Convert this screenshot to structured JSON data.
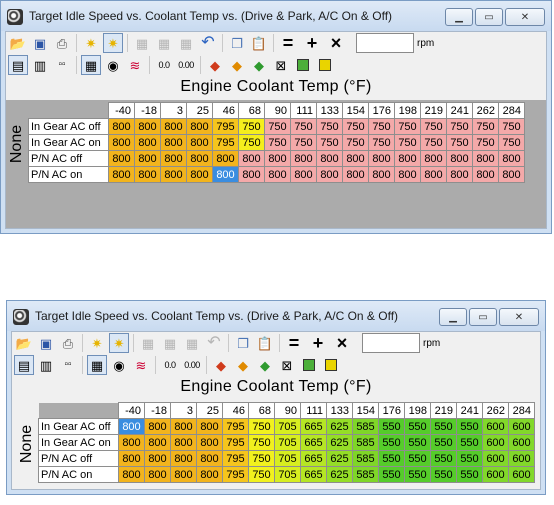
{
  "window1": {
    "title": "Target Idle Speed vs. Coolant Temp vs. (Drive & Park, A/C On & Off)",
    "x_axis_title": "Engine Coolant Temp (°F)",
    "y_axis_title": "None",
    "rpm_value": "",
    "rpm_label": "rpm",
    "columns": [
      "-40",
      "-18",
      "3",
      "25",
      "46",
      "68",
      "90",
      "111",
      "133",
      "154",
      "176",
      "198",
      "219",
      "241",
      "262",
      "284"
    ],
    "rows": [
      {
        "label": "In Gear AC off",
        "values": [
          "800",
          "800",
          "800",
          "800",
          "795",
          "750",
          "750",
          "750",
          "750",
          "750",
          "750",
          "750",
          "750",
          "750",
          "750",
          "750"
        ]
      },
      {
        "label": "In Gear AC on",
        "values": [
          "800",
          "800",
          "800",
          "800",
          "795",
          "750",
          "750",
          "750",
          "750",
          "750",
          "750",
          "750",
          "750",
          "750",
          "750",
          "750"
        ]
      },
      {
        "label": "P/N AC off",
        "values": [
          "800",
          "800",
          "800",
          "800",
          "800",
          "800",
          "800",
          "800",
          "800",
          "800",
          "800",
          "800",
          "800",
          "800",
          "800",
          "800"
        ]
      },
      {
        "label": "P/N AC on",
        "values": [
          "800",
          "800",
          "800",
          "800",
          "800",
          "800",
          "800",
          "800",
          "800",
          "800",
          "800",
          "800",
          "800",
          "800",
          "800",
          "800"
        ]
      }
    ]
  },
  "window2": {
    "title": "Target Idle Speed vs. Coolant Temp vs. (Drive & Park, A/C On & Off)",
    "x_axis_title": "Engine Coolant Temp (°F)",
    "y_axis_title": "None",
    "rpm_value": "",
    "rpm_label": "rpm",
    "columns": [
      "-40",
      "-18",
      "3",
      "25",
      "46",
      "68",
      "90",
      "111",
      "133",
      "154",
      "176",
      "198",
      "219",
      "241",
      "262",
      "284"
    ],
    "rows": [
      {
        "label": "In Gear AC off",
        "values": [
          "800",
          "800",
          "800",
          "800",
          "795",
          "750",
          "705",
          "665",
          "625",
          "585",
          "550",
          "550",
          "550",
          "550",
          "600",
          "600"
        ]
      },
      {
        "label": "In Gear AC on",
        "values": [
          "800",
          "800",
          "800",
          "800",
          "795",
          "750",
          "705",
          "665",
          "625",
          "585",
          "550",
          "550",
          "550",
          "550",
          "600",
          "600"
        ]
      },
      {
        "label": "P/N AC off",
        "values": [
          "800",
          "800",
          "800",
          "800",
          "795",
          "750",
          "705",
          "665",
          "625",
          "585",
          "550",
          "550",
          "550",
          "550",
          "600",
          "600"
        ]
      },
      {
        "label": "P/N AC on",
        "values": [
          "800",
          "800",
          "800",
          "800",
          "795",
          "750",
          "705",
          "665",
          "625",
          "585",
          "550",
          "550",
          "550",
          "550",
          "600",
          "600"
        ]
      }
    ]
  },
  "toolbar": {
    "equals_symbol": "=",
    "plus_symbol": "+",
    "times_symbol": "×",
    "zoom_in_label": "0.0",
    "zoom_out_label": "0.00"
  },
  "icons": [
    "open-folder-icon",
    "save-icon",
    "print-icon",
    "star-icon",
    "star-pressed-icon",
    "copy-table-icon",
    "paste-table-icon",
    "compare-icon",
    "undo-icon",
    "copy-icon",
    "paste-icon",
    "table-view-icon",
    "chart-view-icon",
    "grid-icon",
    "3d-view-icon",
    "graph-icon",
    "increment-icon",
    "decrement-icon",
    "interpolate-icon",
    "smooth-icon",
    "fill-icon",
    "fit-icon",
    "color-scale-icon"
  ],
  "colors": {
    "orange_800": "#f2b41d",
    "yellow_750": "#f5ee1d",
    "pink_750": "#f4a9a9",
    "selected": "#3a8de0",
    "green_550": "#55cc2a"
  }
}
